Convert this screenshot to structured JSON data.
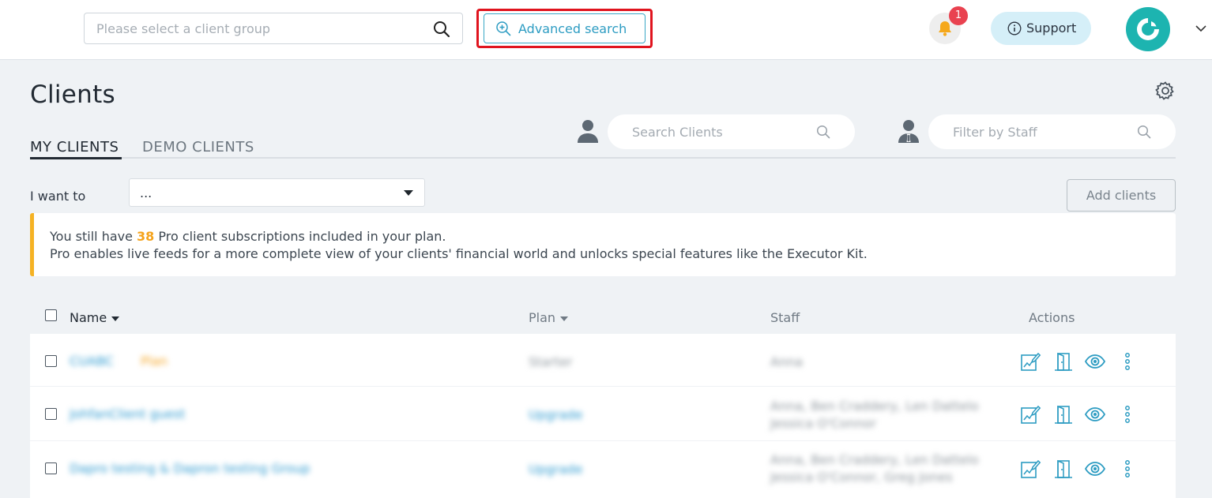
{
  "topbar": {
    "group_placeholder": "Please select a client group",
    "advanced_search": "Advanced search",
    "notification_count": "1",
    "support": "Support"
  },
  "page": {
    "title": "Clients",
    "tabs": [
      "MY CLIENTS",
      "DEMO CLIENTS"
    ],
    "active_tab": "MY CLIENTS",
    "search_placeholder": "Search Clients",
    "staff_placeholder": "Filter by Staff",
    "i_want_to": "I want to",
    "action_select_value": "...",
    "add_clients": "Add clients"
  },
  "notice": {
    "line1_pre": "You still have ",
    "count": "38",
    "line1_post": " Pro client subscriptions included in your plan.",
    "line2": "Pro enables live feeds for a more complete view of your clients' financial world and unlocks special features like the Executor Kit."
  },
  "table": {
    "headers": {
      "name": "Name",
      "plan": "Plan",
      "staff": "Staff",
      "actions": "Actions"
    },
    "rows": [
      {
        "name": "CUABC",
        "tag": "Plan",
        "plan": "Starter",
        "staff1": "Anna",
        "staff2": ""
      },
      {
        "name": "JohfanClient guest",
        "tag": "",
        "plan": "Upgrade",
        "staff1": "Anna, Ben Craddery, Len Dattelo",
        "staff2": "Jessica O'Connor"
      },
      {
        "name": "Dapro testing & Dapron testing Group",
        "tag": "",
        "plan": "Upgrade",
        "staff1": "Anna, Ben Craddery, Len Dattelo",
        "staff2": "Jessica O'Connor, Greg Jones"
      }
    ]
  },
  "colors": {
    "accent": "#2d9cc2",
    "highlight": "#e0141e",
    "warning": "#f5b224",
    "avatar": "#1db4b0",
    "badge": "#e94250"
  }
}
